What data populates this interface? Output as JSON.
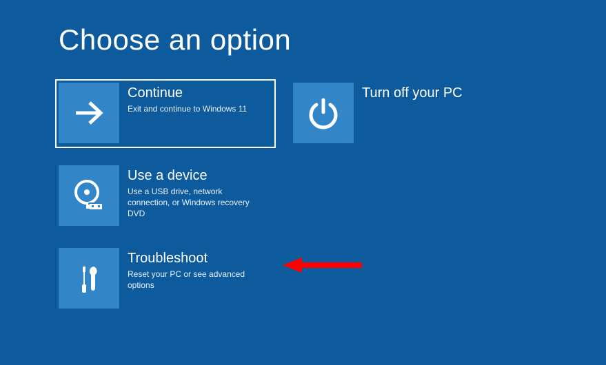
{
  "title": "Choose an option",
  "options": {
    "continue": {
      "title": "Continue",
      "desc": "Exit and continue to Windows 11"
    },
    "turnoff": {
      "title": "Turn off your PC",
      "desc": ""
    },
    "device": {
      "title": "Use a device",
      "desc": "Use a USB drive, network connection, or Windows recovery DVD"
    },
    "troubleshoot": {
      "title": "Troubleshoot",
      "desc": "Reset your PC or see advanced options"
    }
  }
}
